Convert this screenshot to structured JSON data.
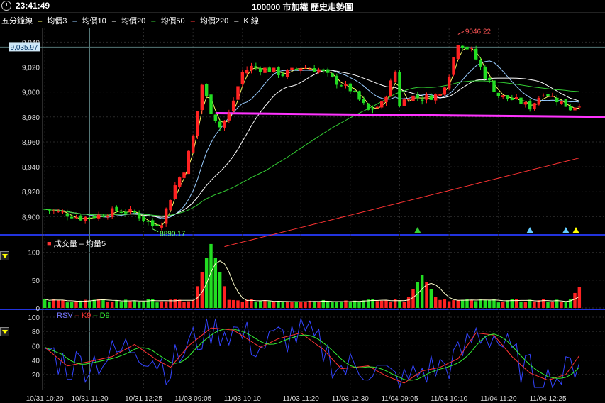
{
  "header": {
    "time": "23:41:49",
    "title": "100000 市加權  歷史走勢圖"
  },
  "legend": {
    "period": "五分鐘線",
    "items": [
      {
        "label": "均價3",
        "color": "#ffff66"
      },
      {
        "label": "均價10",
        "color": "#99ccff"
      },
      {
        "label": "均價20",
        "color": "#ffffff"
      },
      {
        "label": "均價50",
        "color": "#33cc33"
      },
      {
        "label": "均價220",
        "color": "#ff3333"
      },
      {
        "label": "K 線",
        "color": "#ffffff"
      }
    ]
  },
  "volume_legend": {
    "volume": "成交量",
    "avg": "均量5"
  },
  "kd_legend": {
    "rsv": "RSV",
    "k": "K9",
    "d": "D9"
  },
  "crosshair_price": "9,035.97",
  "chart_data": [
    {
      "type": "candlestick",
      "yticks": [
        8900,
        8920,
        8940,
        8960,
        8980,
        9000,
        9020,
        9040
      ],
      "ytick_labels": [
        "8,900",
        "8,920",
        "8,940",
        "8,960",
        "8,980",
        "9,000",
        "9,020",
        "9,040"
      ],
      "ylim": [
        8886,
        9051
      ],
      "n_bars": 120,
      "x_tick_labels": [
        "10/31 10:20",
        "10/31 11:20",
        "10/31 12:25",
        "11/03 09:05",
        "11/03 10:10",
        "11/03 11:20",
        "11/03 12:30",
        "11/04 09:05",
        "11/04 10:10",
        "11/04 11:20",
        "11/04 12:25"
      ],
      "x_tick_bars": [
        0,
        10,
        22,
        33,
        44,
        57,
        68,
        79,
        90,
        101,
        112
      ],
      "annotations": [
        {
          "text": "9046.22",
          "bar": 92,
          "value": 9046.22
        },
        {
          "text": "8890.17",
          "bar": 24,
          "value": 8890.17
        }
      ],
      "support_line": {
        "from": [
          38,
          8983
        ],
        "to": [
          120,
          8980
        ],
        "color": "#ff33ff"
      },
      "markers": [
        {
          "bar": 83,
          "color": "#33cc33"
        },
        {
          "bar": 108,
          "color": "#66ccff"
        },
        {
          "bar": 116,
          "color": "#66ccff"
        },
        {
          "bar": 122,
          "color": "#ffff00"
        }
      ],
      "ohlc_key": [
        [
          0,
          8906
        ],
        [
          4,
          8903
        ],
        [
          8,
          8899
        ],
        [
          12,
          8901
        ],
        [
          16,
          8905
        ],
        [
          20,
          8903
        ],
        [
          24,
          8893
        ],
        [
          26,
          8896
        ],
        [
          29,
          8925
        ],
        [
          31,
          8938
        ],
        [
          33,
          8964
        ],
        [
          35,
          9006
        ],
        [
          37,
          8985
        ],
        [
          39,
          8972
        ],
        [
          41,
          8982
        ],
        [
          44,
          9016
        ],
        [
          46,
          9020
        ],
        [
          50,
          9018
        ],
        [
          53,
          9014
        ],
        [
          57,
          9020
        ],
        [
          61,
          9018
        ],
        [
          65,
          9008
        ],
        [
          68,
          9002
        ],
        [
          72,
          8985
        ],
        [
          75,
          8990
        ],
        [
          78,
          9016
        ],
        [
          79,
          8990
        ],
        [
          81,
          8997
        ],
        [
          84,
          8995
        ],
        [
          88,
          8998
        ],
        [
          90,
          9015
        ],
        [
          92,
          9040
        ],
        [
          95,
          9033
        ],
        [
          98,
          9013
        ],
        [
          101,
          8997
        ],
        [
          105,
          8993
        ],
        [
          108,
          8988
        ],
        [
          111,
          9000
        ],
        [
          114,
          8994
        ],
        [
          117,
          8987
        ],
        [
          120,
          8993
        ]
      ]
    },
    {
      "type": "bar",
      "title": "成交量",
      "yticks": [
        0,
        50,
        100
      ],
      "ylim": [
        0,
        120
      ],
      "spikes": [
        {
          "bar": 37,
          "value": 115
        },
        {
          "bar": 38,
          "value": 40
        },
        {
          "bar": 84,
          "value": 60
        },
        {
          "bar": 120,
          "value": 48
        }
      ],
      "base_value": 10
    },
    {
      "type": "line",
      "title": "KD",
      "yticks": [
        20,
        40,
        60,
        80,
        100
      ],
      "ylim": [
        0,
        100
      ],
      "reference_line": 50,
      "series": [
        {
          "name": "RSV",
          "color": "#3344ff"
        },
        {
          "name": "K9",
          "color": "#ff3333"
        },
        {
          "name": "D9",
          "color": "#33ee33"
        }
      ],
      "k_key": [
        [
          0,
          58
        ],
        [
          5,
          32
        ],
        [
          10,
          38
        ],
        [
          15,
          45
        ],
        [
          20,
          62
        ],
        [
          25,
          40
        ],
        [
          28,
          30
        ],
        [
          32,
          60
        ],
        [
          37,
          85
        ],
        [
          42,
          82
        ],
        [
          48,
          58
        ],
        [
          52,
          70
        ],
        [
          57,
          78
        ],
        [
          62,
          55
        ],
        [
          66,
          28
        ],
        [
          72,
          32
        ],
        [
          76,
          18
        ],
        [
          80,
          8
        ],
        [
          84,
          25
        ],
        [
          88,
          30
        ],
        [
          92,
          42
        ],
        [
          96,
          78
        ],
        [
          100,
          75
        ],
        [
          104,
          45
        ],
        [
          108,
          22
        ],
        [
          112,
          12
        ],
        [
          116,
          20
        ],
        [
          120,
          55
        ],
        [
          124,
          40
        ],
        [
          128,
          55
        ]
      ]
    }
  ]
}
